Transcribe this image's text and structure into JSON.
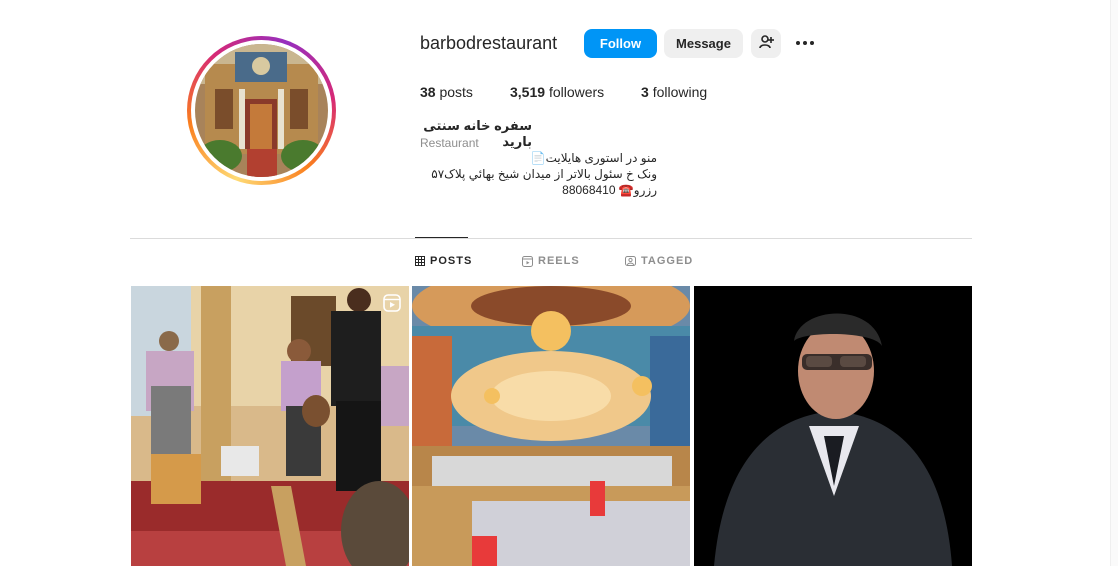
{
  "profile": {
    "username": "barbodrestaurant",
    "follow_label": "Follow",
    "message_label": "Message",
    "stats": {
      "posts": {
        "count": "38",
        "label": "posts"
      },
      "followers": {
        "count": "3,519",
        "label": "followers"
      },
      "following": {
        "count": "3",
        "label": "following"
      }
    },
    "full_name": "سفره خانه سنتی بارید",
    "category": "Restaurant",
    "bio_lines": [
      "منو در استوری هایلایت📄",
      "ونک خ سئول بالاتر از میدان شیخ بهائي پلاک۵۷",
      "رزرو☎️ 88068410"
    ]
  },
  "tabs": [
    {
      "label": "POSTS",
      "icon": "grid-icon",
      "active": true
    },
    {
      "label": "REELS",
      "icon": "reels-icon",
      "active": false
    },
    {
      "label": "TAGGED",
      "icon": "tagged-icon",
      "active": false
    }
  ],
  "colors": {
    "follow_blue": "#0095f6",
    "button_gray": "#efefef",
    "text_primary": "#262626",
    "text_secondary": "#8e8e8e"
  },
  "posts": [
    {
      "kind": "reel",
      "depicts": "live-music-performance"
    },
    {
      "kind": "photo",
      "depicts": "restaurant-dining-hall"
    },
    {
      "kind": "photo",
      "depicts": "portrait-on-black"
    }
  ]
}
